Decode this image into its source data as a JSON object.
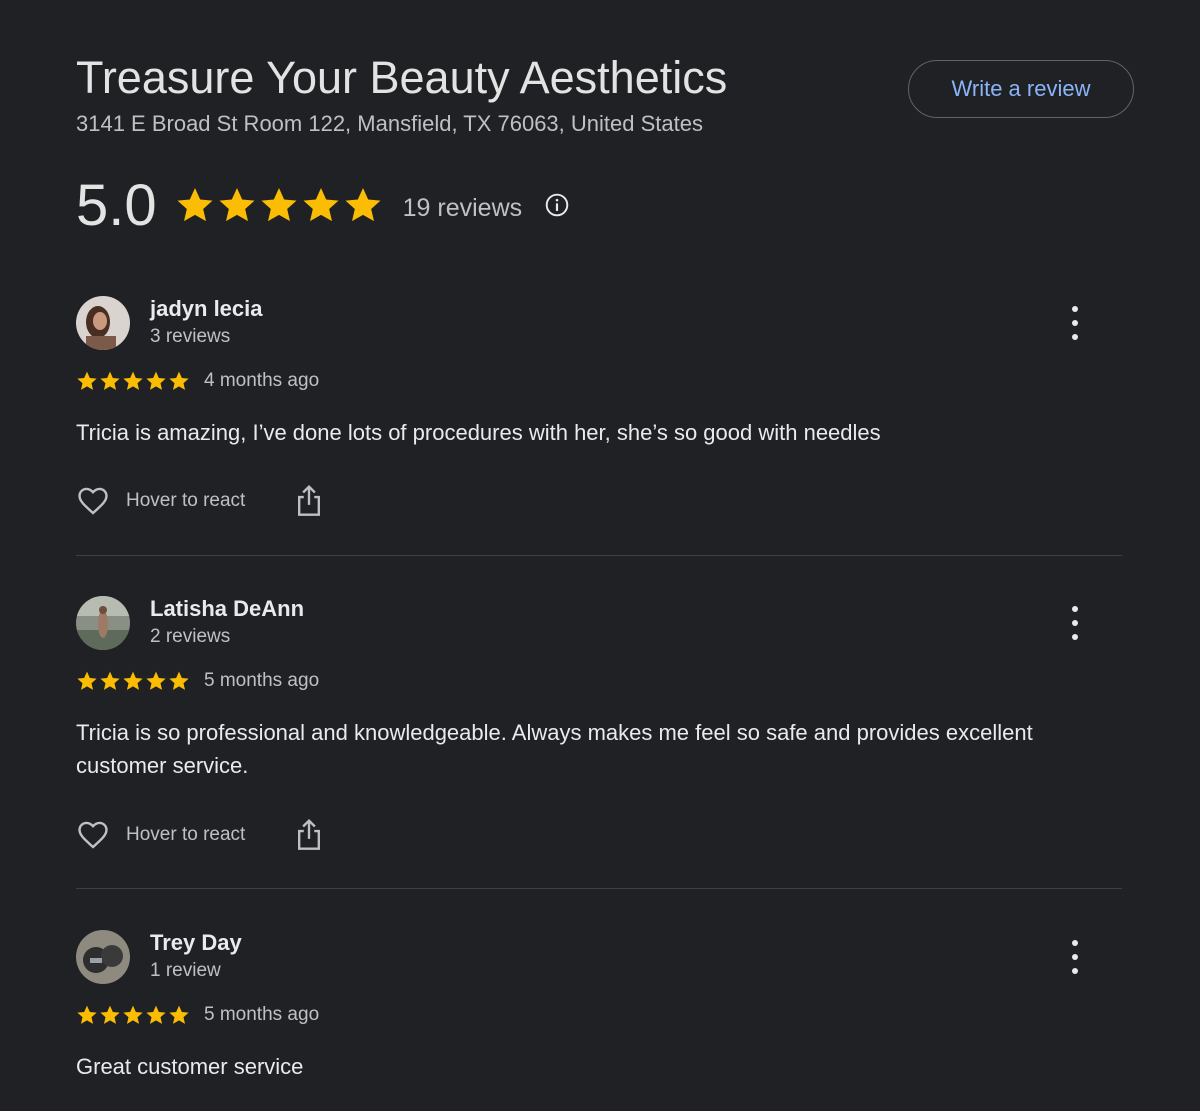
{
  "business": {
    "title": "Treasure Your Beauty Aesthetics",
    "address": "3141 E Broad St Room 122, Mansfield, TX 76063, United States",
    "write_review_label": "Write a review",
    "rating": "5.0",
    "stars": 5,
    "review_count_label": "19 reviews",
    "info_icon": "info-icon"
  },
  "colors": {
    "background": "#202124",
    "star": "#fbbc04",
    "link": "#8ab4f8",
    "text": "#e8eaed",
    "muted": "#bdc1c6",
    "divider": "#3c4043"
  },
  "reviews": [
    {
      "name": "jadyn lecia",
      "meta": "3 reviews",
      "stars": 5,
      "date": "4 months ago",
      "text": "Tricia is amazing, I’ve done lots of procedures with her, she’s so good with needles",
      "react_label": "Hover to react"
    },
    {
      "name": "Latisha DeAnn",
      "meta": "2 reviews",
      "stars": 5,
      "date": "5 months ago",
      "text": "Tricia is so professional and knowledgeable. Always makes me feel so safe and provides excellent customer service.",
      "react_label": "Hover to react"
    },
    {
      "name": "Trey Day",
      "meta": "1 review",
      "stars": 5,
      "date": "5 months ago",
      "text": "Great customer service",
      "react_label": ""
    }
  ]
}
